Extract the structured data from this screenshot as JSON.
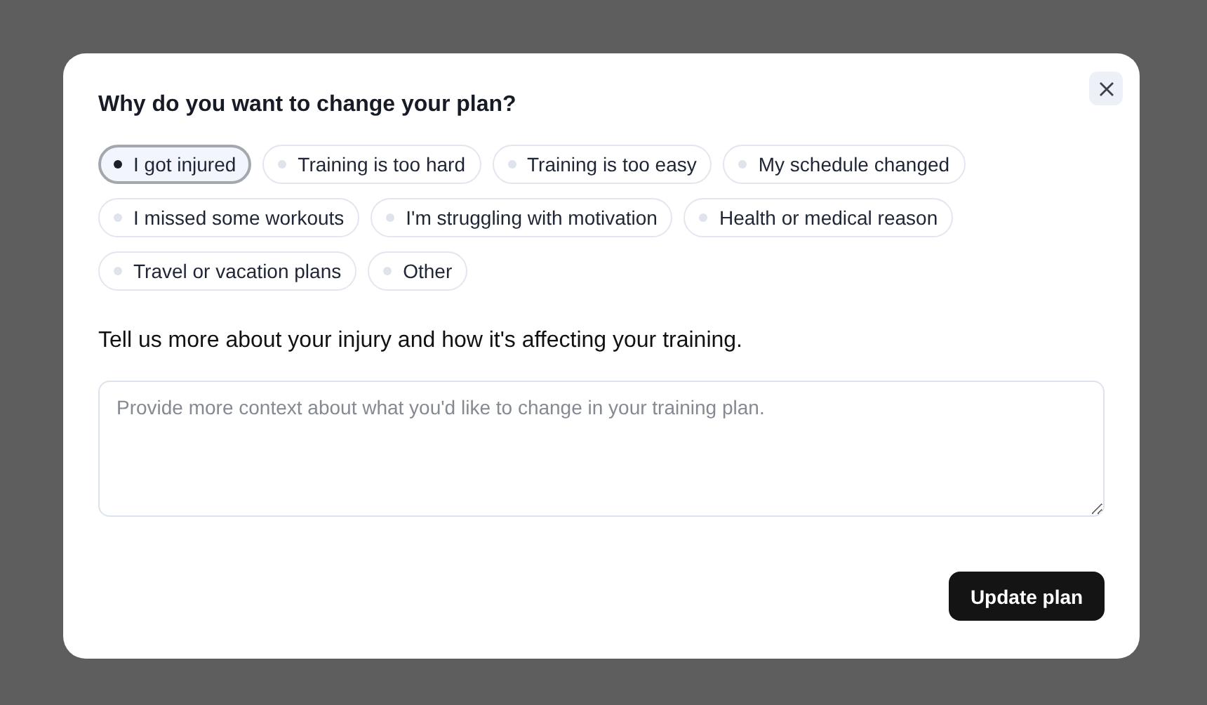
{
  "dialog": {
    "title": "Why do you want to change your plan?",
    "reasons": [
      {
        "label": "I got injured",
        "selected": true
      },
      {
        "label": "Training is too hard",
        "selected": false
      },
      {
        "label": "Training is too easy",
        "selected": false
      },
      {
        "label": "My schedule changed",
        "selected": false
      },
      {
        "label": "I missed some workouts",
        "selected": false
      },
      {
        "label": "I'm struggling with motivation",
        "selected": false
      },
      {
        "label": "Health or medical reason",
        "selected": false
      },
      {
        "label": "Travel or vacation plans",
        "selected": false
      },
      {
        "label": "Other",
        "selected": false
      }
    ],
    "details_prompt": "Tell us more about your injury and how it's affecting your training.",
    "details_field": {
      "placeholder": "Provide more context about what you'd like to change in your training plan."
    },
    "submit_button": "Update plan"
  }
}
